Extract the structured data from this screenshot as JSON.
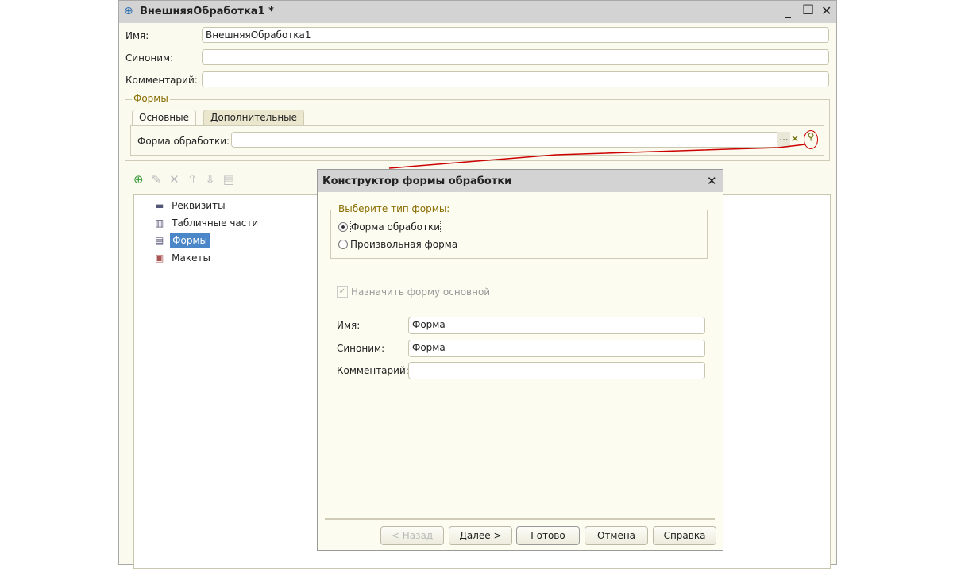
{
  "window": {
    "title": "ВнешняяОбработка1 *",
    "minimize": "_",
    "maximize": "☐",
    "close": "✕"
  },
  "fields": {
    "name_label": "Имя:",
    "name_value": "ВнешняяОбработка1",
    "synonym_label": "Синоним:",
    "synonym_value": "",
    "comment_label": "Комментарий:",
    "comment_value": ""
  },
  "forms_group": {
    "legend": "Формы",
    "tabs": [
      "Основные",
      "Дополнительные"
    ],
    "form_label": "Форма обработки:",
    "form_value": "",
    "btn_select": "...",
    "btn_clear": "✕"
  },
  "tree": {
    "items": [
      "Реквизиты",
      "Табличные части",
      "Формы",
      "Макеты"
    ],
    "selected": "Формы"
  },
  "dialog": {
    "title": "Конструктор формы обработки",
    "close": "✕",
    "type_legend": "Выберите тип формы:",
    "type_options": [
      "Форма обработки",
      "Произвольная форма"
    ],
    "selected_type": "Форма обработки",
    "set_main_label": "Назначить форму основной",
    "set_main_checked": true,
    "name_label": "Имя:",
    "name_value": "Форма",
    "synonym_label": "Синоним:",
    "synonym_value": "Форма",
    "comment_label": "Комментарий:",
    "comment_value": "",
    "buttons": [
      "< Назад",
      "Далее >",
      "Готово",
      "Отмена",
      "Справка"
    ]
  },
  "colors": {
    "background": "#fbfaef",
    "accent": "#8a6d00",
    "selection": "#4a86c8",
    "annotation": "#cc0000"
  }
}
